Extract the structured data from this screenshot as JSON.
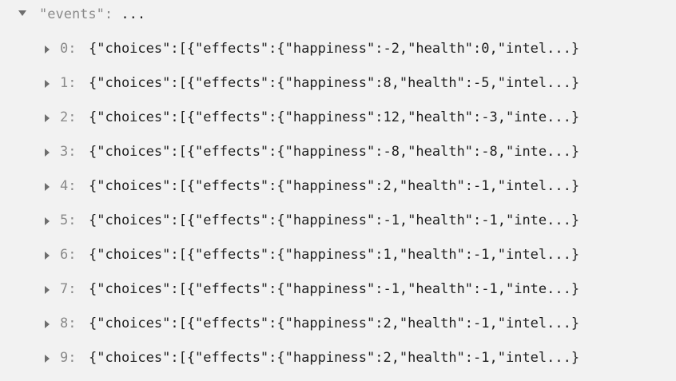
{
  "root": {
    "key": "\"events\"",
    "colon": ":",
    "ellipsis": "..."
  },
  "events": [
    {
      "index": "0:",
      "preview": "{\"choices\":[{\"effects\":{\"happiness\":-2,\"health\":0,\"intel...}"
    },
    {
      "index": "1:",
      "preview": "{\"choices\":[{\"effects\":{\"happiness\":8,\"health\":-5,\"intel...}"
    },
    {
      "index": "2:",
      "preview": "{\"choices\":[{\"effects\":{\"happiness\":12,\"health\":-3,\"inte...}"
    },
    {
      "index": "3:",
      "preview": "{\"choices\":[{\"effects\":{\"happiness\":-8,\"health\":-8,\"inte...}"
    },
    {
      "index": "4:",
      "preview": "{\"choices\":[{\"effects\":{\"happiness\":2,\"health\":-1,\"intel...}"
    },
    {
      "index": "5:",
      "preview": "{\"choices\":[{\"effects\":{\"happiness\":-1,\"health\":-1,\"inte...}"
    },
    {
      "index": "6:",
      "preview": "{\"choices\":[{\"effects\":{\"happiness\":1,\"health\":-1,\"intel...}"
    },
    {
      "index": "7:",
      "preview": "{\"choices\":[{\"effects\":{\"happiness\":-1,\"health\":-1,\"inte...}"
    },
    {
      "index": "8:",
      "preview": "{\"choices\":[{\"effects\":{\"happiness\":2,\"health\":-1,\"intel...}"
    },
    {
      "index": "9:",
      "preview": "{\"choices\":[{\"effects\":{\"happiness\":2,\"health\":-1,\"intel...}"
    }
  ],
  "colors": {
    "background": "#f2f2f2",
    "key_gray": "#8a8a8a",
    "value_text": "#1f1f1f",
    "toggle_gray": "#6e6e6e"
  }
}
